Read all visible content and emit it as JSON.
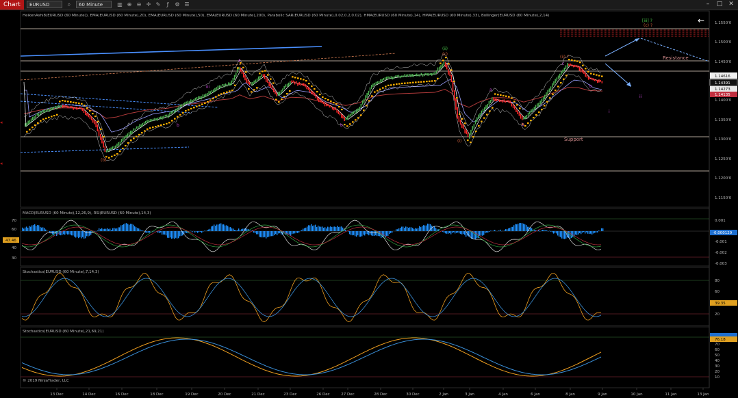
{
  "toolbar": {
    "tab": "Chart",
    "symbol": "EURUSD",
    "interval": "60 Minute"
  },
  "colors": {
    "background": "#000000",
    "heiken_up": "#4caf50",
    "heiken_down": "#ff2a2a",
    "sar": "#ffb000",
    "ema20": "#ffffff",
    "ema50": "#9aa0ff",
    "ema200": "#b03a3a",
    "macd_hist": "#1e90ff",
    "stoch_d": "#f0a020",
    "stoch_k": "#3a8fd8"
  },
  "panels": {
    "price_title": "HeikenAshi8(EURUSD (60 Minute)), EMA(EURUSD (60 Minute),20), EMA(EURUSD (60 Minute),50), EMA(EURUSD (60 Minute),200), Parabolic SAR(EURUSD (60 Minute),0.02,0.2,0.02), HMA(EURUSD (60 Minute),14), HMA(EURUSD (60 Minute),33), Bollinger(EURUSD (60 Minute),2,14)",
    "macd_title": "MACD(EURUSD (60 Minute),12,26,9), RSI(EURUSD (60 Minute),14,3)",
    "stoch1_title": "Stochastics(EURUSD (60 Minute),7,14,3)",
    "stoch2_title": "Stochastics(EURUSD (60 Minute),21,69,21)",
    "copyright": "© 2019 NinjaTrader, LLC"
  },
  "price_axis": [
    "1.1550'0",
    "1.1500'0",
    "1.1450'0",
    "1.1400'0",
    "1.1350'0",
    "1.1300'0",
    "1.1250'0",
    "1.1200'0",
    "1.1150'0"
  ],
  "price_badges": [
    "1.14616",
    "1.14391",
    "1.14273",
    "1.14135"
  ],
  "macd_axis": [
    "0.001",
    "-0.001",
    "-0.002",
    "-0.003"
  ],
  "macd_badge": "-0.000129",
  "rsi_left_axis": [
    "70",
    "60",
    "40",
    "30"
  ],
  "rsi_badge": "47.46",
  "stoch1_axis": [
    "80",
    "60",
    "40",
    "20"
  ],
  "stoch1_badge": "39.35",
  "stoch2_axis": [
    "80",
    "70",
    "60",
    "50",
    "40",
    "30",
    "20",
    "10"
  ],
  "stoch2_badge": "76.18",
  "dates": [
    "13 Dec",
    "14 Dec",
    "16 Dec",
    "18 Dec",
    "19 Dec",
    "20 Dec",
    "21 Dec",
    "23 Dec",
    "26 Dec",
    "27 Dec",
    "28 Dec",
    "30 Dec",
    "2 Jan",
    "3 Jan",
    "4 Jan",
    "6 Jan",
    "8 Jan",
    "9 Jan",
    "10 Jan",
    "11 Jan",
    "13 Jan"
  ],
  "annotations": {
    "resistance": "Resistance",
    "support": "Support",
    "wave_b_paren": "(b)",
    "wave_a": "a",
    "wave_iii": "iii",
    "wave_b1": "b",
    "wave_b2": "b",
    "wave_ii_green": "(ii)",
    "wave_c_green": "(c)",
    "wave_i_paren": "(i)",
    "wave_a2": "a",
    "wave_b3": "b",
    "wave_ii_q": "(ii) ?",
    "wave_c": "c",
    "wave_b4": "b",
    "wave_iii_green_q": "[iii] ?",
    "wave_c_q": "(c) ?",
    "wave_ii_purple": "ii",
    "wave_i_purple": "i"
  }
}
